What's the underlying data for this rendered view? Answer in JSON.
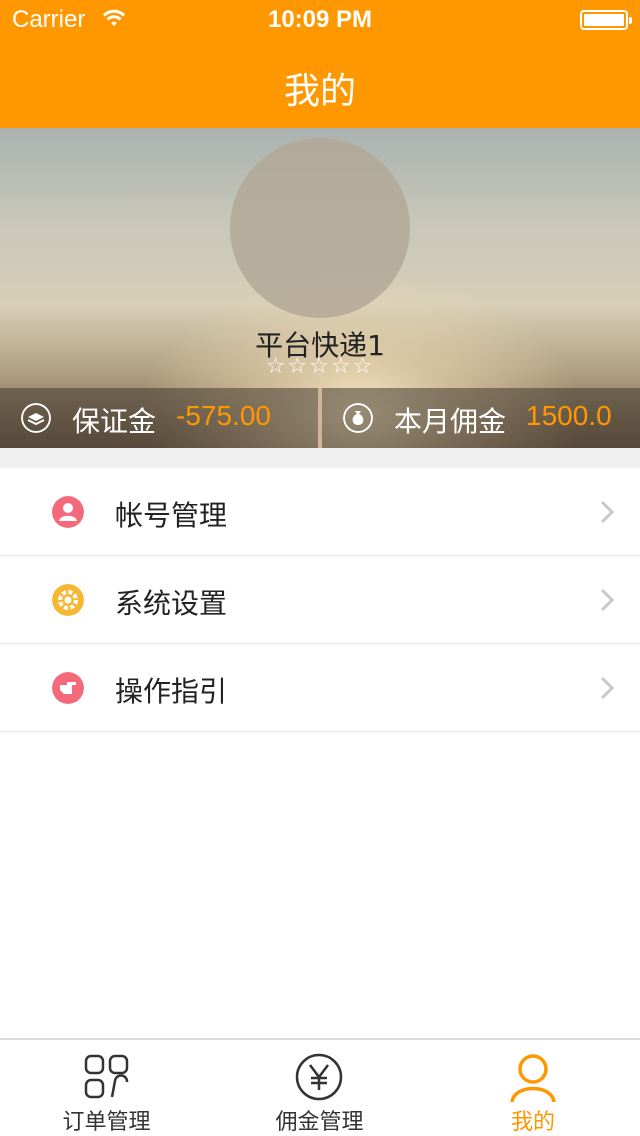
{
  "status_bar": {
    "carrier": "Carrier",
    "time": "10:09 PM"
  },
  "nav": {
    "title": "我的"
  },
  "profile": {
    "name": "平台快递1",
    "stars": "☆☆☆☆☆",
    "deposit": {
      "label": "保证金",
      "value": "-575.00"
    },
    "commission": {
      "label": "本月佣金",
      "value": "1500.0"
    }
  },
  "menu": {
    "items": [
      {
        "label": "帐号管理",
        "icon": "account-icon",
        "color": "#f46a7b"
      },
      {
        "label": "系统设置",
        "icon": "settings-icon",
        "color": "#f7b733"
      },
      {
        "label": "操作指引",
        "icon": "guide-icon",
        "color": "#f46a7b"
      }
    ]
  },
  "tabs": [
    {
      "label": "订单管理",
      "icon": "orders-grid-icon"
    },
    {
      "label": "佣金管理",
      "icon": "yen-icon"
    },
    {
      "label": "我的",
      "icon": "profile-icon",
      "active": true
    }
  ],
  "colors": {
    "accent": "#ff9800",
    "divider": "#e5e5e5"
  }
}
